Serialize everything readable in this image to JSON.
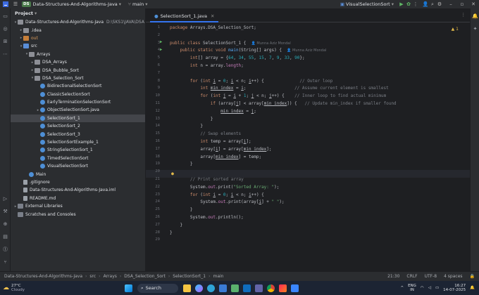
{
  "titlebar": {
    "project_badge": "DS",
    "project_name": "Data-Structures-And-Algorithms-Java",
    "branch": "main",
    "run_config": "VisualSelectionSort"
  },
  "project_panel": {
    "title": "Project",
    "tree": [
      {
        "label": "Data-Structures-And-Algorithms-Java",
        "extra": "D:\\SKS1\\JAVA\\DSA",
        "indent": 0,
        "arrow": "▾",
        "icon": "folder"
      },
      {
        "label": ".idea",
        "indent": 1,
        "arrow": "▸",
        "icon": "folder"
      },
      {
        "label": "out",
        "indent": 1,
        "arrow": "▸",
        "icon": "folder orange",
        "style": "t-orange"
      },
      {
        "label": "src",
        "indent": 1,
        "arrow": "▾",
        "icon": "folder blue"
      },
      {
        "label": "Arrays",
        "indent": 2,
        "arrow": "▾",
        "icon": "folder"
      },
      {
        "label": "DSA_Arrays",
        "indent": 3,
        "arrow": "▸",
        "icon": "folder"
      },
      {
        "label": "DSA_Bubble_Sort",
        "indent": 3,
        "arrow": "▸",
        "icon": "folder"
      },
      {
        "label": "DSA_Selection_Sort",
        "indent": 3,
        "arrow": "▾",
        "icon": "folder"
      },
      {
        "label": "BidirectionalSelectionSort",
        "indent": 4,
        "arrow": "",
        "icon": "java"
      },
      {
        "label": "ClassicSelectionSort",
        "indent": 4,
        "arrow": "",
        "icon": "java"
      },
      {
        "label": "EarlyTerminationSelectionSort",
        "indent": 4,
        "arrow": "",
        "icon": "java"
      },
      {
        "label": "ObjectSelectionSort.java",
        "indent": 4,
        "arrow": "▸",
        "icon": "java"
      },
      {
        "label": "SelectionSort_1",
        "indent": 4,
        "arrow": "",
        "icon": "java",
        "selected": true
      },
      {
        "label": "SelectionSort_2",
        "indent": 4,
        "arrow": "",
        "icon": "java"
      },
      {
        "label": "SelectionSort_3",
        "indent": 4,
        "arrow": "",
        "icon": "java"
      },
      {
        "label": "SelectionSortExample_1",
        "indent": 4,
        "arrow": "",
        "icon": "java"
      },
      {
        "label": "StringSelectionSort_1",
        "indent": 4,
        "arrow": "",
        "icon": "java"
      },
      {
        "label": "TimedSelectionSort",
        "indent": 4,
        "arrow": "",
        "icon": "java"
      },
      {
        "label": "VisualSelectionSort",
        "indent": 4,
        "arrow": "",
        "icon": "java"
      },
      {
        "label": "Main",
        "indent": 2,
        "arrow": "",
        "icon": "java"
      },
      {
        "label": ".gitignore",
        "indent": 1,
        "arrow": "",
        "icon": "file"
      },
      {
        "label": "Data-Structures-And-Algorithms-Java.iml",
        "indent": 1,
        "arrow": "",
        "icon": "file"
      },
      {
        "label": "README.md",
        "indent": 1,
        "arrow": "",
        "icon": "file"
      },
      {
        "label": "External Libraries",
        "indent": 0,
        "arrow": "▸",
        "icon": "lib"
      },
      {
        "label": "Scratches and Consoles",
        "indent": 0,
        "arrow": "",
        "icon": "lib"
      }
    ]
  },
  "editor": {
    "tab_label": "SelectionSort_1.java",
    "warning_count": "1",
    "author_hint": "Munna Aziz Mondal",
    "lines": [
      {
        "n": "1",
        "html": "<span class=\"kw\">package</span> Arrays.DSA_Selection_Sort;"
      },
      {
        "n": "2",
        "html": ""
      },
      {
        "n": "3",
        "html": "<span class=\"kw\">public class</span> SelectionSort_1 {  <span class=\"hint\">&#128100; Munna Aziz Mondal</span>"
      },
      {
        "n": "4",
        "html": "    <span class=\"kw\">public static void</span> <span class=\"mth\">main</span>(String[] args) {  <span class=\"hint\">&#128100; Munna Aziz Mondal</span>"
      },
      {
        "n": "5",
        "html": "        <span class=\"kw\">int</span>[] array = {<span class=\"num\">64</span>, <span class=\"num\">34</span>, <span class=\"num\">55</span>, <span class=\"num\">15</span>, <span class=\"num\">7</span>, <span class=\"num\">9</span>, <span class=\"num\">33</span>, <span class=\"num\">90</span>};"
      },
      {
        "n": "6",
        "html": "        <span class=\"kw\">int</span> n = array.<span class=\"fld\">length</span>;"
      },
      {
        "n": "7",
        "html": ""
      },
      {
        "n": "8",
        "html": "        <span class=\"kw\">for</span> (<span class=\"kw\">int</span> <span class=\"un\">i</span> = <span class=\"num\">0</span>; <span class=\"un\">i</span> &lt; n; <span class=\"un\">i</span>++) {              <span class=\"cmt\">// Outer loop</span>"
      },
      {
        "n": "9",
        "html": "            <span class=\"kw\">int</span> <span class=\"un\">min_index</span> = <span class=\"un\">i</span>;                   <span class=\"cmt\">// Assume current element is smallest</span>"
      },
      {
        "n": "10",
        "html": "            <span class=\"kw\">for</span> (<span class=\"kw\">int</span> <span class=\"un\">j</span> = <span class=\"un\">i</span> + <span class=\"num\">1</span>; <span class=\"un\">j</span> &lt; n; <span class=\"un\">j</span>++) {    <span class=\"cmt\">// Inner loop to find actual minimum</span>"
      },
      {
        "n": "11",
        "html": "                <span class=\"kw\">if</span> (array[<span class=\"un\">j</span>] &lt; array[<span class=\"un\">min_index</span>]) {   <span class=\"cmt\">// Update min_index if smaller found</span>"
      },
      {
        "n": "12",
        "html": "                    <span class=\"un\">min_index</span> = <span class=\"un\">j</span>;"
      },
      {
        "n": "13",
        "html": "                }"
      },
      {
        "n": "14",
        "html": "            }"
      },
      {
        "n": "15",
        "html": "            <span class=\"cmt\">// Swap elements</span>"
      },
      {
        "n": "16",
        "html": "            <span class=\"kw\">int</span> temp = array[<span class=\"un\">i</span>];"
      },
      {
        "n": "17",
        "html": "            array[<span class=\"un\">i</span>] = array[<span class=\"un\">min_index</span>];"
      },
      {
        "n": "18",
        "html": "            array[<span class=\"un\">min_index</span>] = temp;"
      },
      {
        "n": "19",
        "html": "        }"
      },
      {
        "n": "20",
        "html": ""
      },
      {
        "n": "21",
        "html": "        <span class=\"cmt\">// Print sorted array</span>"
      },
      {
        "n": "22",
        "html": "        System.<span class=\"fld\">out</span>.print(<span class=\"str\">\"Sorted Array: \"</span>);"
      },
      {
        "n": "23",
        "html": "        <span class=\"kw\">for</span> (<span class=\"kw\">int</span> <span class=\"un\">i</span> = <span class=\"num\">0</span>; <span class=\"un\">i</span> &lt; n; <span class=\"un\">i</span>++) {"
      },
      {
        "n": "24",
        "html": "            System.<span class=\"fld\">out</span>.print(array[<span class=\"un\">i</span>] + <span class=\"str\">\" \"</span>);"
      },
      {
        "n": "25",
        "html": "        }"
      },
      {
        "n": "26",
        "html": "        System.<span class=\"fld\">out</span>.println();"
      },
      {
        "n": "27",
        "html": "    }"
      },
      {
        "n": "28",
        "html": "}"
      },
      {
        "n": "29",
        "html": ""
      }
    ]
  },
  "statusbar": {
    "breadcrumbs": [
      "Data-Structures-And-Algorithms-Java",
      "src",
      "Arrays",
      "DSA_Selection_Sort",
      "SelectionSort_1",
      "main"
    ],
    "position": "21:30",
    "line_ending": "CRLF",
    "encoding": "UTF-8",
    "indent": "4 spaces"
  },
  "taskbar": {
    "weather_temp": "27°C",
    "weather_desc": "Cloudy",
    "search_label": "Search",
    "time": "16:27",
    "date": "14-07-2025",
    "lang": "ENG",
    "lang2": "IN"
  },
  "colors": {
    "accent": "#3574f0",
    "selection": "#43454a",
    "editor_bg": "#1e1f22",
    "panel_bg": "#2b2d30"
  }
}
